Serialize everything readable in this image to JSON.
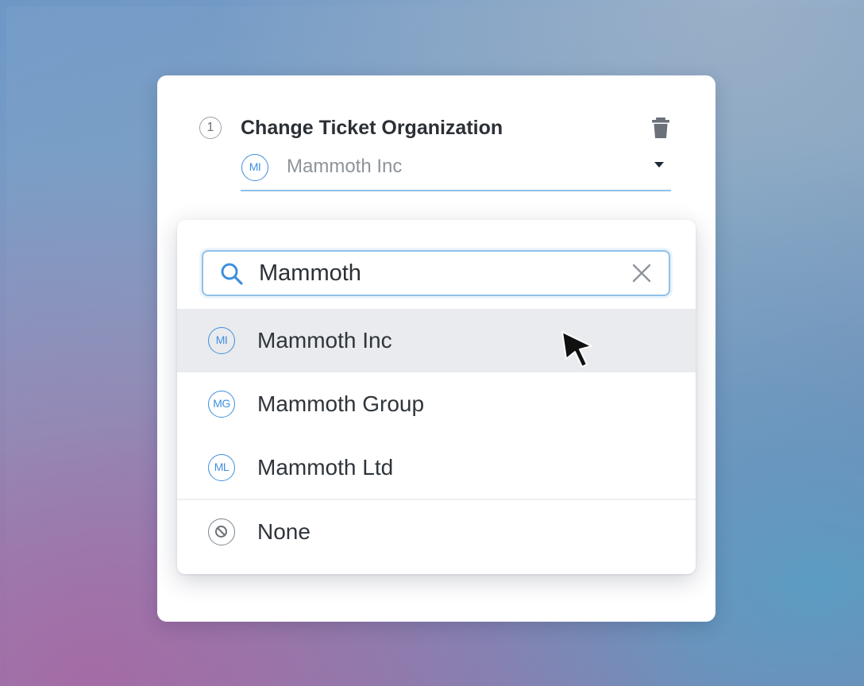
{
  "card": {
    "step_number": "1",
    "step_title": "Change Ticket Organization",
    "delete_icon": "trash-icon",
    "field": {
      "badge": "MI",
      "value": "Mammoth Inc",
      "caret_icon": "caret-down-icon"
    }
  },
  "dropdown": {
    "search": {
      "icon": "search-icon",
      "value": "Mammoth",
      "clear_icon": "close-icon"
    },
    "options": [
      {
        "badge": "MI",
        "label": "Mammoth Inc",
        "hovered": true
      },
      {
        "badge": "MG",
        "label": "Mammoth Group",
        "hovered": false
      },
      {
        "badge": "ML",
        "label": "Mammoth Ltd",
        "hovered": false
      }
    ],
    "none_option": {
      "icon": "no-entry-icon",
      "label": "None"
    }
  },
  "colors": {
    "accent": "#3f8fdd",
    "focus_border": "#8ec1e8",
    "hover_bg": "#e9ebee",
    "title_text": "#2b3036"
  }
}
